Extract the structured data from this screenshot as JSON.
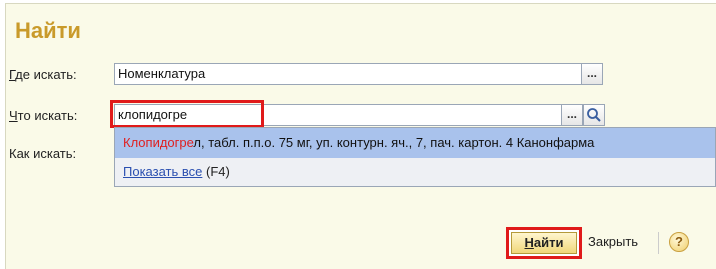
{
  "dialog": {
    "title": "Найти"
  },
  "where": {
    "label_underlined": "Г",
    "label_rest": "де искать:",
    "value": "Номенклатура",
    "button_label": "..."
  },
  "what": {
    "label_underlined": "Ч",
    "label_rest": "то искать:",
    "value": "клопидогре",
    "button_label": "..."
  },
  "how": {
    "label": "Как искать:"
  },
  "dropdown": {
    "item1_match": "Клопидогре",
    "item1_rest": "л, табл. п.п.о. 75 мг, уп. контурн. яч., 7, пач. картон. 4 Канонфарма",
    "show_all_link": "Показать все",
    "show_all_hint": "(F4)"
  },
  "footer": {
    "find_underlined": "Н",
    "find_rest": "айти",
    "close_label": "Закрыть",
    "help_label": "?"
  },
  "colors": {
    "title": "#c99a2a",
    "highlight": "#e01a1a",
    "selected_row": "#a9c2ec",
    "link": "#2a4fb0"
  },
  "icons": [
    "search-icon",
    "help-icon"
  ]
}
